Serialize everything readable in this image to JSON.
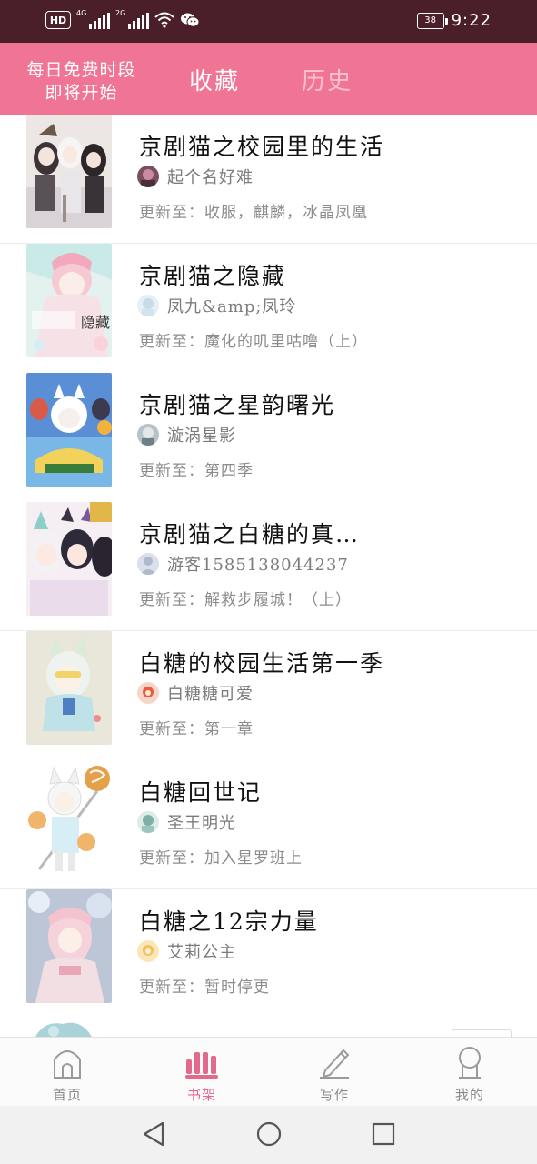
{
  "status_bar": {
    "hd": "HD",
    "sim1": "4G",
    "sim2": "2G",
    "battery": "38",
    "time": "9:22"
  },
  "header": {
    "free_slot_line1": "每日免费时段",
    "free_slot_line2": "即将开始",
    "tabs": [
      {
        "label": "收藏",
        "active": true
      },
      {
        "label": "历史",
        "active": false
      }
    ],
    "bg_color": "#f07594"
  },
  "books": [
    {
      "title": "京剧猫之校园里的生活",
      "author": "起个名好难",
      "update": "更新至：收服，麒麟，冰晶凤凰"
    },
    {
      "title": "京剧猫之隐藏",
      "author": "凤九&amp;凤玲",
      "update": "更新至：魔化的叽里咕噜（上）",
      "cover_text": "隐藏"
    },
    {
      "title": "京剧猫之星韵曙光",
      "author": "漩涡星影",
      "update": "更新至：第四季"
    },
    {
      "title": "京剧猫之白糖的真…",
      "author": "游客1585138044237",
      "update": "更新至：解救步履城！（上）"
    },
    {
      "title": "白糖的校园生活第一季",
      "author": "白糖糖可爱",
      "update": "更新至：第一章"
    },
    {
      "title": "白糖回世记",
      "author": "圣王明光",
      "update": "更新至：加入星罗班上"
    },
    {
      "title": "白糖之12宗力量",
      "author": "艾莉公主",
      "update": "更新至：暂时停更"
    }
  ],
  "bottom_nav": [
    {
      "label": "首页",
      "icon": "home-icon",
      "active": false
    },
    {
      "label": "书架",
      "icon": "bookshelf-icon",
      "active": true
    },
    {
      "label": "写作",
      "icon": "pen-icon",
      "active": false
    },
    {
      "label": "我的",
      "icon": "profile-icon",
      "active": false
    }
  ],
  "accent_color": "#e36a8a"
}
